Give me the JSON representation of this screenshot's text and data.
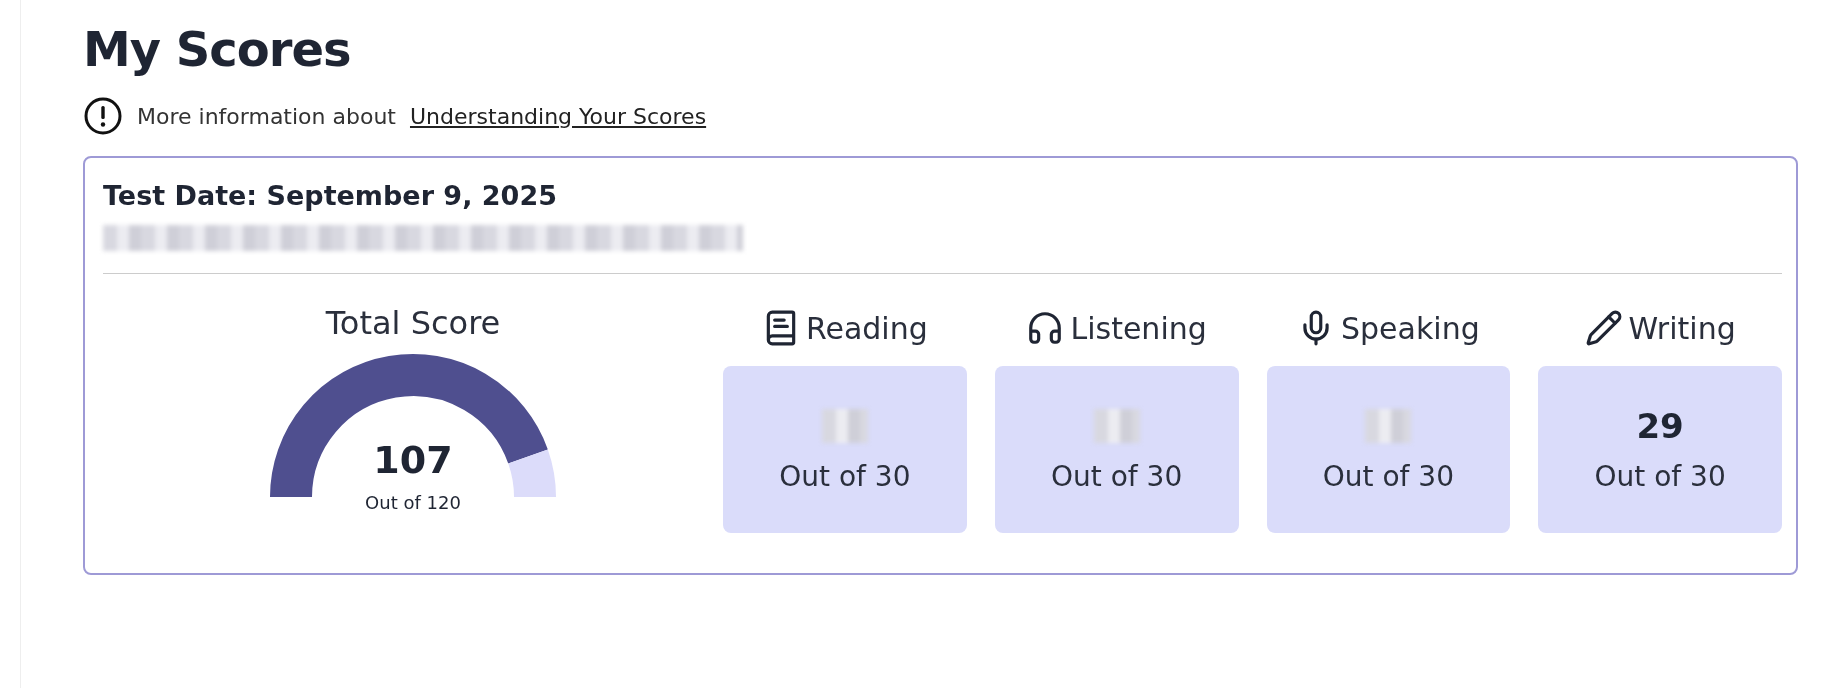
{
  "title": "My Scores",
  "info": {
    "text": "More information about",
    "link": "Understanding Your Scores"
  },
  "card": {
    "test_date": "Test Date: September 9, 2025",
    "detail_line": {
      "redacted": true
    },
    "total": {
      "label": "Total Score",
      "value": "107",
      "out_of": "Out of 120"
    },
    "sections": [
      {
        "name": "Reading",
        "redacted": true,
        "out_of": "Out of 30"
      },
      {
        "name": "Listening",
        "redacted": true,
        "out_of": "Out of 30"
      },
      {
        "name": "Speaking",
        "redacted": true,
        "out_of": "Out of 30"
      },
      {
        "name": "Writing",
        "redacted": false,
        "score": "29",
        "out_of": "Out of 30"
      }
    ]
  }
}
